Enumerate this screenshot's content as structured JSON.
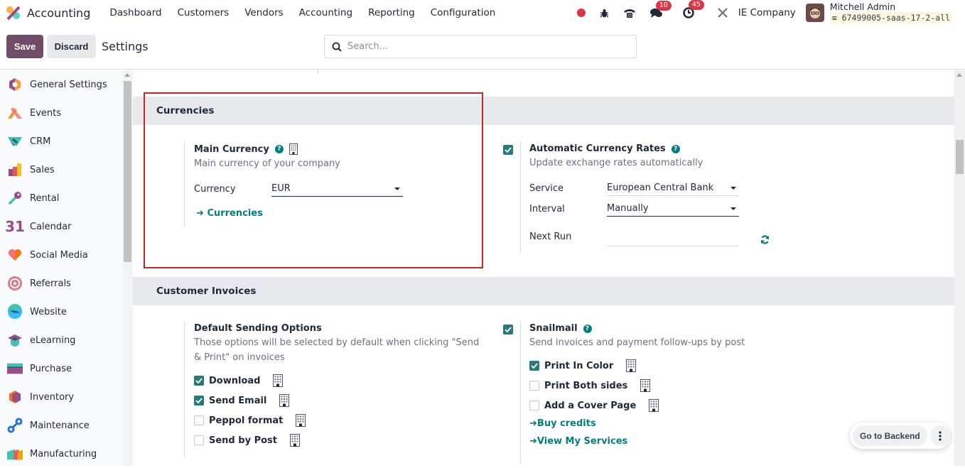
{
  "navbar": {
    "app_name": "Accounting",
    "menu": [
      "Dashboard",
      "Customers",
      "Vendors",
      "Accounting",
      "Reporting",
      "Configuration"
    ],
    "messages_count": "10",
    "activities_count": "45",
    "company": "IE Company",
    "user_name": "Mitchell Admin",
    "database": "67499005-saas-17-2-all"
  },
  "controlbar": {
    "save_label": "Save",
    "discard_label": "Discard",
    "title": "Settings",
    "search_placeholder": "Search..."
  },
  "sidebar": {
    "items": [
      {
        "label": "General Settings",
        "icon": "general-settings-icon"
      },
      {
        "label": "Events",
        "icon": "events-icon"
      },
      {
        "label": "CRM",
        "icon": "crm-icon"
      },
      {
        "label": "Sales",
        "icon": "sales-icon"
      },
      {
        "label": "Rental",
        "icon": "rental-icon"
      },
      {
        "label": "Calendar",
        "icon": "calendar-icon"
      },
      {
        "label": "Social Media",
        "icon": "social-media-icon"
      },
      {
        "label": "Referrals",
        "icon": "referrals-icon"
      },
      {
        "label": "Website",
        "icon": "website-icon"
      },
      {
        "label": "eLearning",
        "icon": "elearning-icon"
      },
      {
        "label": "Purchase",
        "icon": "purchase-icon"
      },
      {
        "label": "Inventory",
        "icon": "inventory-icon"
      },
      {
        "label": "Maintenance",
        "icon": "maintenance-icon"
      },
      {
        "label": "Manufacturing",
        "icon": "manufacturing-icon"
      }
    ],
    "calendar_glyph": "31"
  },
  "currencies": {
    "heading": "Currencies",
    "main_currency": {
      "title": "Main Currency",
      "desc": "Main currency of your company",
      "field_label": "Currency",
      "value": "EUR",
      "link": "Currencies"
    },
    "auto_rates": {
      "checked": true,
      "title": "Automatic Currency Rates",
      "desc": "Update exchange rates automatically",
      "service_label": "Service",
      "service_value": "European Central Bank",
      "interval_label": "Interval",
      "interval_value": "Manually",
      "next_run_label": "Next Run",
      "next_run_value": ""
    }
  },
  "customer_invoices": {
    "heading": "Customer Invoices",
    "sending": {
      "title": "Default Sending Options",
      "desc": "Those options will be selected by default when clicking \"Send & Print\" on invoices",
      "options": [
        {
          "label": "Download",
          "checked": true
        },
        {
          "label": "Send Email",
          "checked": true
        },
        {
          "label": "Peppol format",
          "checked": false
        },
        {
          "label": "Send by Post",
          "checked": false
        }
      ]
    },
    "snailmail": {
      "checked": true,
      "title": "Snailmail",
      "desc": "Send invoices and payment follow-ups by post",
      "options": [
        {
          "label": "Print In Color",
          "checked": true
        },
        {
          "label": "Print Both sides",
          "checked": false
        },
        {
          "label": "Add a Cover Page",
          "checked": false
        }
      ],
      "links": [
        "Buy credits",
        "View My Services"
      ]
    }
  },
  "floating": {
    "backend_label": "Go to Backend"
  },
  "colors": {
    "brand": "#714b67",
    "accent": "#017e84",
    "checkbox": "#277a7c",
    "badge": "#dc3545",
    "highlight": "#c62828"
  }
}
